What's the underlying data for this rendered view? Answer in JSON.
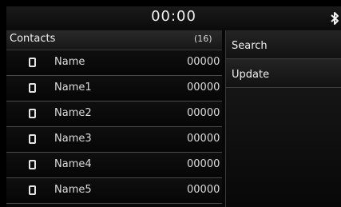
{
  "status_bar": {
    "time": "00:00",
    "icon": "bluetooth-icon"
  },
  "contacts": {
    "title": "Contacts",
    "count": "(16)",
    "items": [
      {
        "name": "Name",
        "number": "00000"
      },
      {
        "name": "Name1",
        "number": "00000"
      },
      {
        "name": "Name2",
        "number": "00000"
      },
      {
        "name": "Name3",
        "number": "00000"
      },
      {
        "name": "Name4",
        "number": "00000"
      },
      {
        "name": "Name5",
        "number": "00000"
      }
    ]
  },
  "menu": {
    "items": [
      {
        "label": "Search"
      },
      {
        "label": "Update"
      }
    ]
  }
}
